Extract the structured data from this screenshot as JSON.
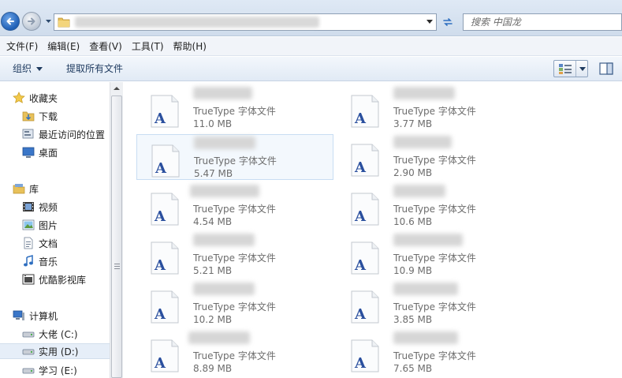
{
  "search": {
    "placeholder": "搜索 中国龙"
  },
  "menu": [
    "文件(F)",
    "编辑(E)",
    "查看(V)",
    "工具(T)",
    "帮助(H)"
  ],
  "toolbar": {
    "organize_label": "组织",
    "extract_label": "提取所有文件"
  },
  "sidebar": {
    "favorites": {
      "label": "收藏夹",
      "items": [
        "下载",
        "最近访问的位置",
        "桌面"
      ]
    },
    "libraries": {
      "label": "库",
      "items": [
        "视频",
        "图片",
        "文档",
        "音乐",
        "优酷影视库"
      ]
    },
    "computer": {
      "label": "计算机",
      "items": [
        "大佬 (C:)",
        "实用 (D:)",
        "学习 (E:)"
      ],
      "selected": "实用 (D:)"
    }
  },
  "files": [
    {
      "type": "TrueType 字体文件",
      "size": "11.0 MB"
    },
    {
      "type": "TrueType 字体文件",
      "size": "3.77 MB"
    },
    {
      "type": "TrueType 字体文件",
      "size": "5.47 MB"
    },
    {
      "type": "TrueType 字体文件",
      "size": "2.90 MB"
    },
    {
      "type": "TrueType 字体文件",
      "size": "4.54 MB"
    },
    {
      "type": "TrueType 字体文件",
      "size": "10.6 MB"
    },
    {
      "type": "TrueType 字体文件",
      "size": "5.21 MB"
    },
    {
      "type": "TrueType 字体文件",
      "size": "10.9 MB"
    },
    {
      "type": "TrueType 字体文件",
      "size": "10.2 MB"
    },
    {
      "type": "TrueType 字体文件",
      "size": "3.85 MB"
    },
    {
      "type": "TrueType 字体文件",
      "size": "8.89 MB"
    },
    {
      "type": "TrueType 字体文件",
      "size": "7.65 MB"
    }
  ],
  "icons": {
    "back": "back-arrow-icon",
    "forward": "forward-arrow-icon",
    "refresh": "refresh-icon",
    "font_file": "truetype-font-file-icon"
  },
  "colors": {
    "accent": "#1f5fb6",
    "toolbar": "#e1eaf5",
    "font_glyph": "#2a4f9e"
  }
}
